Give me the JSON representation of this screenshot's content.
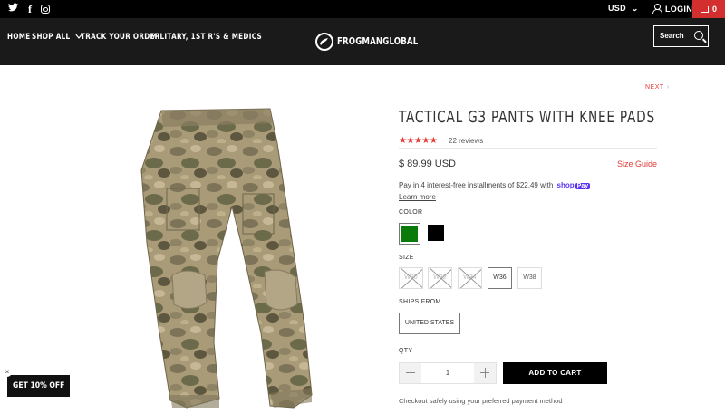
{
  "topbar": {
    "social": [
      "twitter-icon",
      "facebook-icon",
      "instagram-icon"
    ],
    "currency": "USD",
    "login_label": "LOGIN",
    "cart_count": "0"
  },
  "header": {
    "nav": {
      "home": "HOME",
      "shop_all": "SHOP ALL",
      "track_order": "TRACK YOUR ORDER",
      "military": "MILITARY, 1ST R'S & MEDICS"
    },
    "logo_text": "FROGMANGLOBAL",
    "search_placeholder": "Search"
  },
  "product": {
    "next_label": "NEXT",
    "title": "TACTICAL G3 PANTS WITH KNEE PADS",
    "rating": 5,
    "stars": "★★★★★",
    "reviews": "22 reviews",
    "price": "$ 89.99 USD",
    "size_guide": "Size Guide",
    "installments_text": "Pay in 4 interest-free installments of $22.49 with",
    "shoppay_shop": "shop",
    "shoppay_pay": "Pay",
    "learn_more": "Learn more",
    "color_label": "COLOR",
    "colors": [
      {
        "name": "green",
        "hex": "#0a7a0a",
        "selected": true
      },
      {
        "name": "black",
        "hex": "#000000",
        "selected": false
      }
    ],
    "size_label": "SIZE",
    "sizes": [
      {
        "label": "W30",
        "available": false
      },
      {
        "label": "W32",
        "available": false
      },
      {
        "label": "W34",
        "available": false
      },
      {
        "label": "W36",
        "available": true,
        "selected": true
      },
      {
        "label": "W38",
        "available": true
      }
    ],
    "ships_from_label": "SHIPS FROM",
    "ships_from_value": "UNITED STATES",
    "qty_label": "QTY",
    "qty_value": "1",
    "add_to_cart": "ADD TO CART",
    "checkout_note": "Checkout safely using your preferred payment method"
  },
  "promo": {
    "label": "GET 10% OFF",
    "close": "×"
  },
  "colors": {
    "accent": "#e53935",
    "cart_bg": "#d32f2f",
    "header_bg": "#1a1a1a",
    "shoppay": "#5a31f4"
  }
}
